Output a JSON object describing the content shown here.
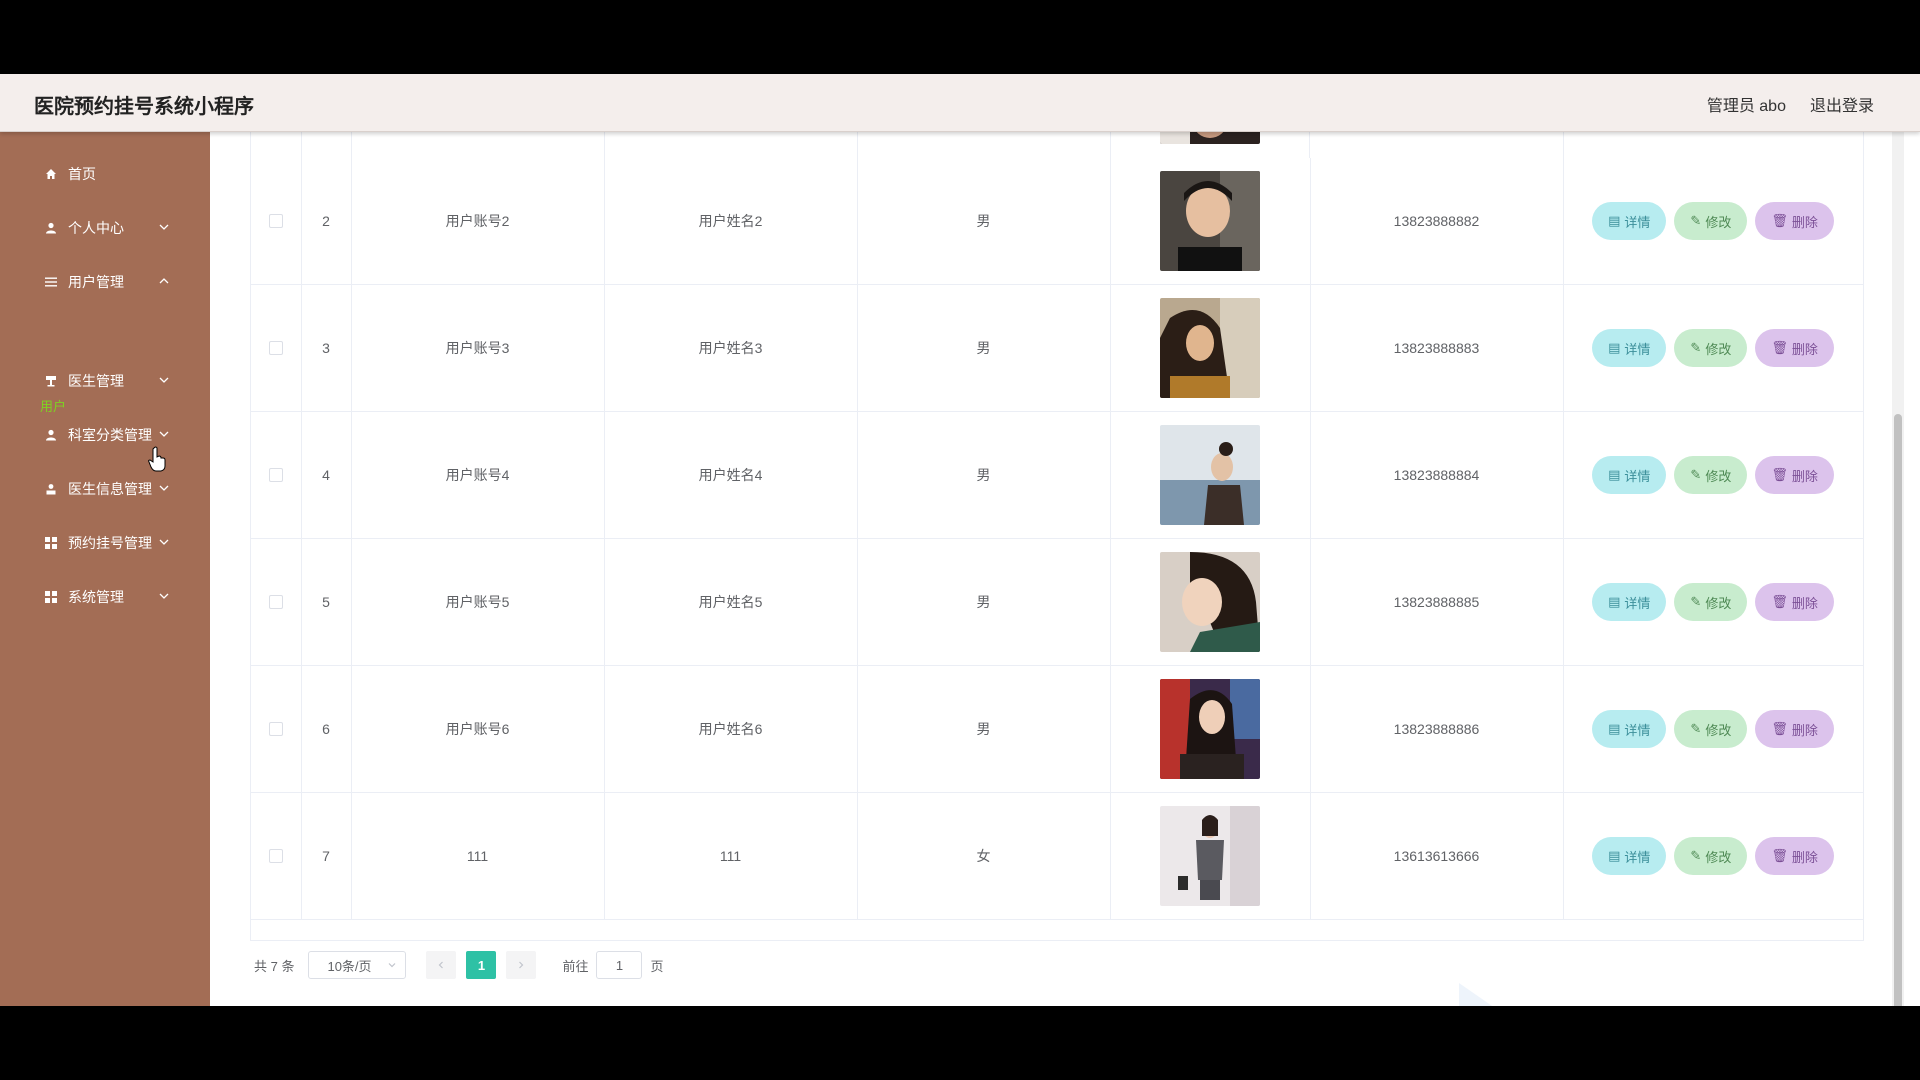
{
  "header": {
    "title": "医院预约挂号系统小程序",
    "admin_label": "管理员 abo",
    "logout_label": "退出登录"
  },
  "sidebar": {
    "items": [
      {
        "label": "首页",
        "icon": "home-icon"
      },
      {
        "label": "个人中心",
        "icon": "person-icon"
      },
      {
        "label": "用户管理",
        "icon": "list-icon"
      },
      {
        "label": "医生管理",
        "icon": "stand-icon"
      },
      {
        "label": "科室分类管理",
        "icon": "person-icon"
      },
      {
        "label": "医生信息管理",
        "icon": "user-icon"
      },
      {
        "label": "预约挂号管理",
        "icon": "grid-icon"
      },
      {
        "label": "系统管理",
        "icon": "grid-icon"
      }
    ],
    "sub_item": "用户"
  },
  "table": {
    "rows": [
      {
        "index": "2",
        "account": "用户账号2",
        "name": "用户姓名2",
        "gender": "男",
        "phone": "13823888882"
      },
      {
        "index": "3",
        "account": "用户账号3",
        "name": "用户姓名3",
        "gender": "男",
        "phone": "13823888883"
      },
      {
        "index": "4",
        "account": "用户账号4",
        "name": "用户姓名4",
        "gender": "男",
        "phone": "13823888884"
      },
      {
        "index": "5",
        "account": "用户账号5",
        "name": "用户姓名5",
        "gender": "男",
        "phone": "13823888885"
      },
      {
        "index": "6",
        "account": "用户账号6",
        "name": "用户姓名6",
        "gender": "男",
        "phone": "13823888886"
      },
      {
        "index": "7",
        "account": "111",
        "name": "111",
        "gender": "女",
        "phone": "13613613666"
      }
    ],
    "actions": {
      "detail": "详情",
      "edit": "修改",
      "delete": "删除"
    }
  },
  "pagination": {
    "total": "共 7 条",
    "page_size": "10条/页",
    "current_page": "1",
    "goto_label": "前往",
    "goto_value": "1",
    "page_unit": "页"
  },
  "colors": {
    "sidebar": "#a36d55",
    "topbar": "#f4eeec",
    "active_page": "#2ec1a5",
    "detail_btn": "#b7ecf0",
    "edit_btn": "#c8ecce",
    "delete_btn": "#dcc3ec"
  }
}
